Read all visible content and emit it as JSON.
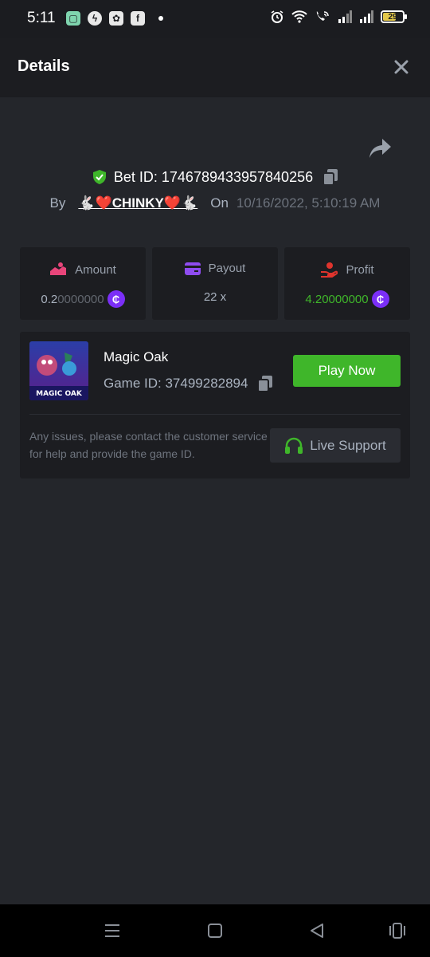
{
  "status_bar": {
    "time": "5:11",
    "battery": "29",
    "notifications": [
      "chat-app-icon",
      "messenger-icon",
      "image-app-icon",
      "facebook-icon"
    ]
  },
  "header": {
    "title": "Details"
  },
  "bet": {
    "label": "Bet ID: 1746789433957840256",
    "by_label": "By",
    "user": "🐇❤️CHINKY❤️🐇",
    "on_label": "On",
    "date": "10/16/2022, 5:10:19 AM"
  },
  "stats": {
    "amount": {
      "label": "Amount",
      "value_main": "0.2",
      "value_dim": "0000000"
    },
    "payout": {
      "label": "Payout",
      "value": "22 x"
    },
    "profit": {
      "label": "Profit",
      "value_main": "4.2",
      "value_dim": "0000000"
    }
  },
  "game": {
    "name": "Magic Oak",
    "id_label": "Game ID: 37499282894",
    "thumb_text": "MAGIC OAK",
    "play_label": "Play Now",
    "issue_text": "Any issues, please contact the customer service for help and provide the game ID.",
    "support_label": "Live Support"
  },
  "colors": {
    "accent_green": "#3fb62a",
    "coin_purple": "#7b2ff7",
    "amount_pink": "#e8457a",
    "payout_purple": "#8f4cf0",
    "profit_red": "#e0342d"
  }
}
